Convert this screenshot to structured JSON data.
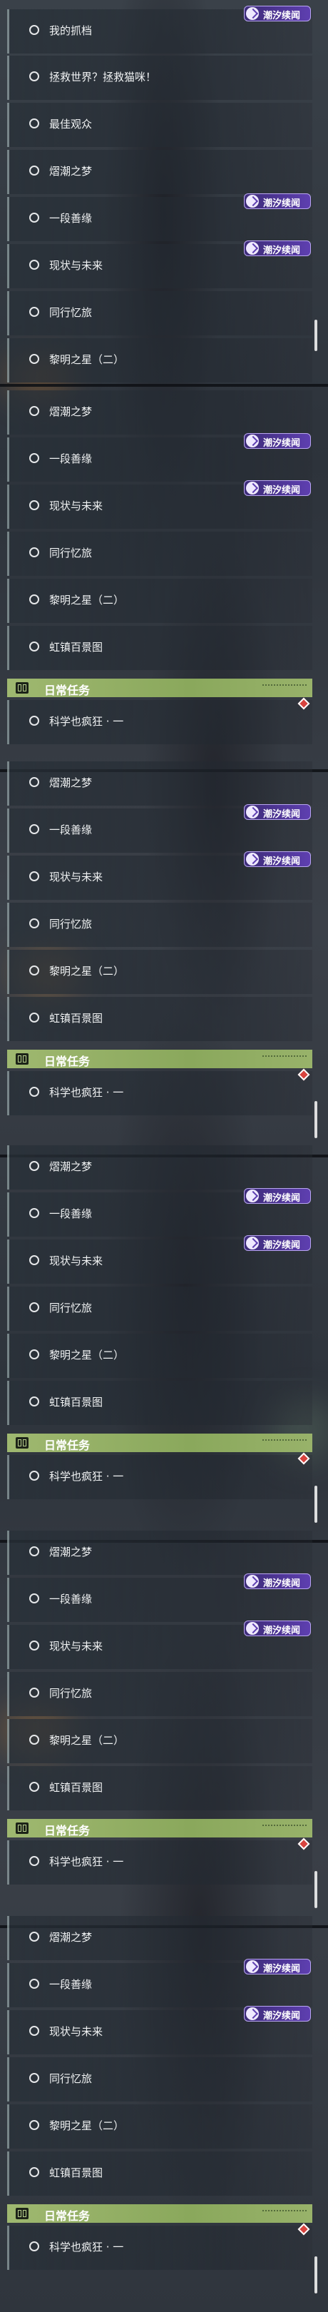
{
  "badge_label": "潮汐续闻",
  "daily_header_title": "日常任务",
  "panels": [
    {
      "items": [
        "我的抓档",
        "拯救世界？拯救猫咪！",
        "最佳观众",
        "熠潮之梦",
        "一段善缘",
        "现状与未来",
        "同行忆旅",
        "黎明之星（二）"
      ]
    },
    {
      "items": [
        "熠潮之梦",
        "一段善缘",
        "现状与未来",
        "同行忆旅",
        "黎明之星（二）",
        "虹镇百景图"
      ],
      "daily": [
        "科学也疯狂 · 一"
      ]
    },
    {
      "items": [
        "熠潮之梦",
        "一段善缘",
        "现状与未来",
        "同行忆旅",
        "黎明之星（二）",
        "虹镇百景图"
      ],
      "daily": [
        "科学也疯狂 · 一"
      ]
    },
    {
      "items": [
        "熠潮之梦",
        "一段善缘",
        "现状与未来",
        "同行忆旅",
        "黎明之星（二）",
        "虹镇百景图"
      ],
      "daily": [
        "科学也疯狂 · 一"
      ]
    },
    {
      "items": [
        "熠潮之梦",
        "一段善缘",
        "现状与未来",
        "同行忆旅",
        "黎明之星（二）",
        "虹镇百景图"
      ],
      "daily": [
        "科学也疯狂 · 一"
      ]
    },
    {
      "items": [
        "熠潮之梦",
        "一段善缘",
        "现状与未来",
        "同行忆旅",
        "黎明之星（二）",
        "虹镇百景图"
      ],
      "daily": [
        "科学也疯狂 · 一"
      ]
    }
  ]
}
